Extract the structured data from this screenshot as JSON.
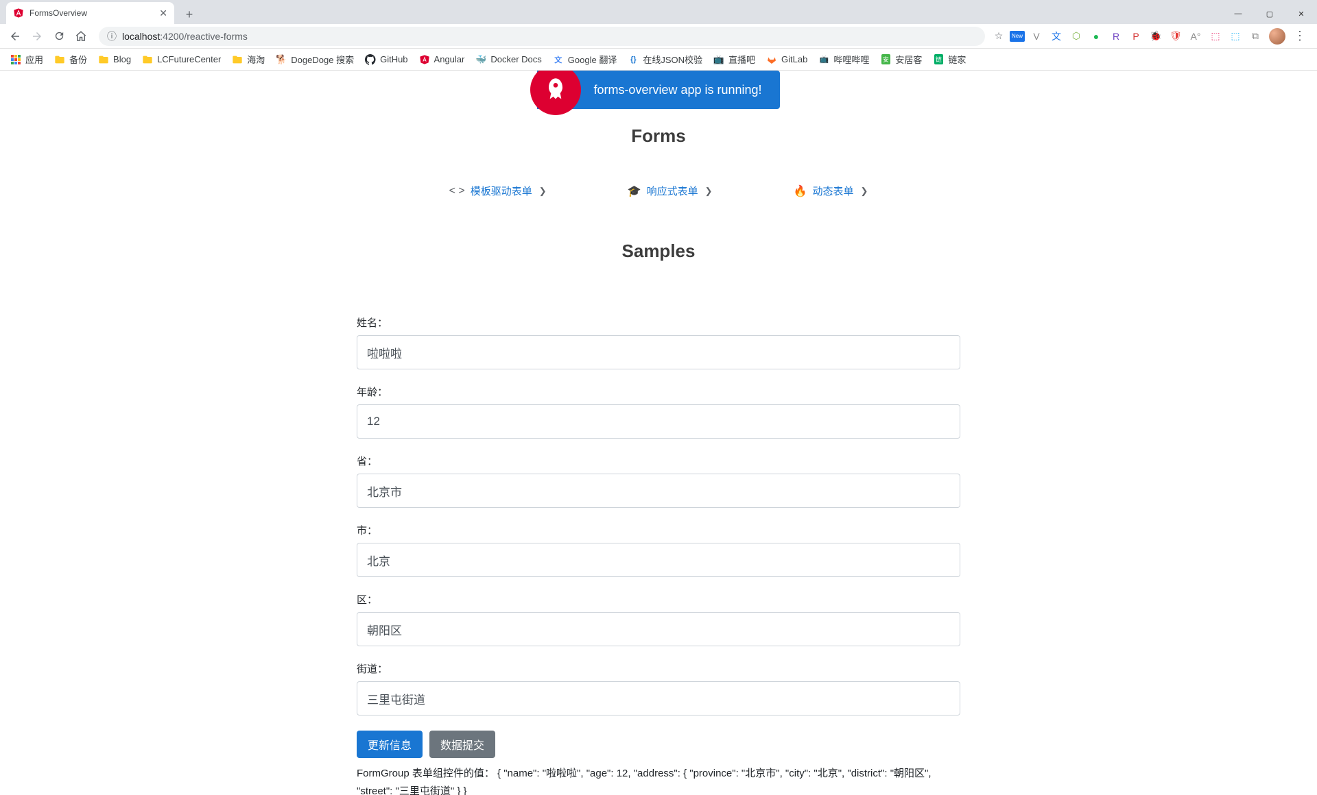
{
  "browser": {
    "tab_title": "FormsOverview",
    "url_info_symbol": "ⓘ",
    "url_host": "localhost",
    "url_port": ":4200",
    "url_path": "/reactive-forms"
  },
  "win_controls": {
    "min": "—",
    "max": "▢",
    "close": "✕"
  },
  "extensions": {
    "star": "☆",
    "items": [
      "New",
      "V",
      "文",
      "⬡",
      "●",
      "R",
      "P",
      "🐞",
      "🛡",
      "A°",
      "⬚",
      "⬚",
      "⧉"
    ]
  },
  "bookmarks": [
    {
      "icon": "apps",
      "label": "应用"
    },
    {
      "icon": "folder",
      "label": "备份"
    },
    {
      "icon": "folder",
      "label": "Blog"
    },
    {
      "icon": "folder",
      "label": "LCFutureCenter"
    },
    {
      "icon": "folder",
      "label": "海淘"
    },
    {
      "icon": "dog",
      "label": "DogeDoge 搜索"
    },
    {
      "icon": "gh",
      "label": "GitHub"
    },
    {
      "icon": "ng",
      "label": "Angular"
    },
    {
      "icon": "docker",
      "label": "Docker Docs"
    },
    {
      "icon": "gt",
      "label": "Google 翻译"
    },
    {
      "icon": "json",
      "label": "在线JSON校验"
    },
    {
      "icon": "live",
      "label": "直播吧"
    },
    {
      "icon": "gl",
      "label": "GitLab"
    },
    {
      "icon": "bili",
      "label": "哔哩哔哩"
    },
    {
      "icon": "anjuke",
      "label": "安居客"
    },
    {
      "icon": "lianj",
      "label": "链家"
    }
  ],
  "hero": {
    "text": "forms-overview app is running!"
  },
  "sections": {
    "forms": "Forms",
    "samples": "Samples"
  },
  "links": [
    {
      "pre": "< >",
      "label": "模板驱动表单"
    },
    {
      "pre": "🎓",
      "label": "响应式表单"
    },
    {
      "pre": "🔥",
      "label": "动态表单"
    }
  ],
  "form": {
    "fields": [
      {
        "key": "name",
        "label": "姓名：",
        "value": "啦啦啦"
      },
      {
        "key": "age",
        "label": "年龄：",
        "value": "12"
      },
      {
        "key": "province",
        "label": "省：",
        "value": "北京市"
      },
      {
        "key": "city",
        "label": "市：",
        "value": "北京"
      },
      {
        "key": "district",
        "label": "区：",
        "value": "朝阳区"
      },
      {
        "key": "street",
        "label": "街道：",
        "value": "三里屯街道"
      }
    ],
    "btn_update": "更新信息",
    "btn_submit": "数据提交",
    "output_prefix": "FormGroup 表单组控件的值：",
    "output_json": "{ \"name\": \"啦啦啦\", \"age\": 12, \"address\": { \"province\": \"北京市\", \"city\": \"北京\", \"district\": \"朝阳区\", \"street\": \"三里屯街道\" } }"
  }
}
